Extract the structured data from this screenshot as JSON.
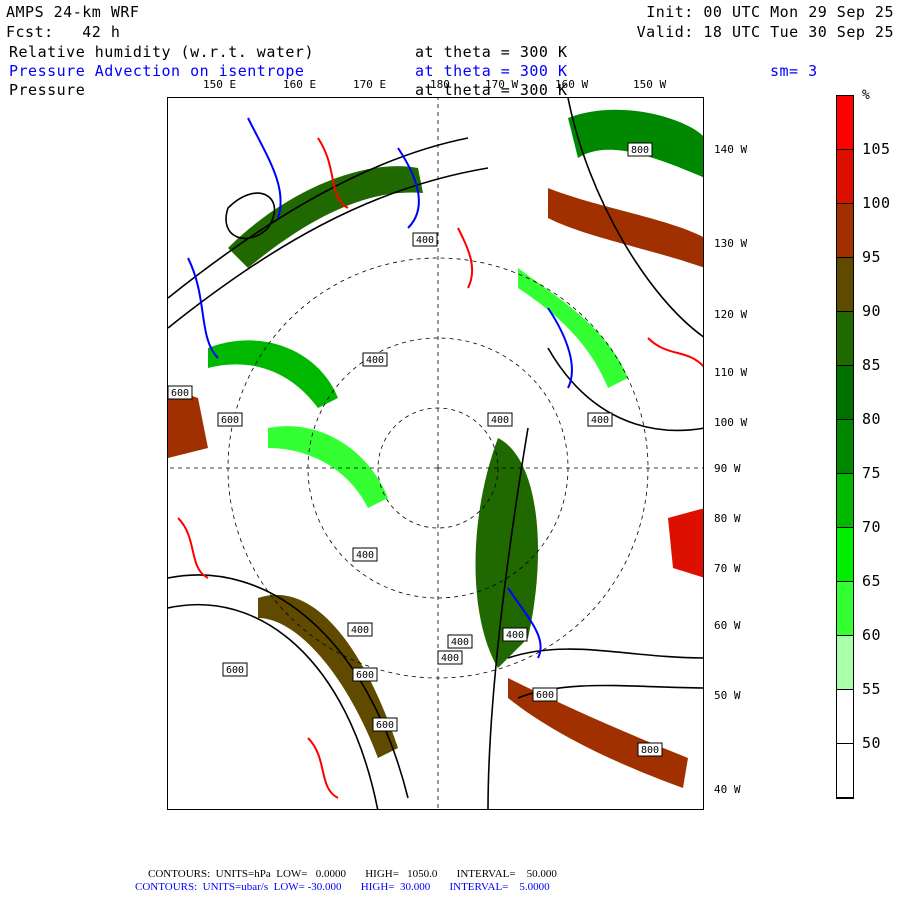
{
  "header": {
    "model": "AMPS 24-km WRF",
    "forecast": "Fcst:   42 h",
    "init": "Init: 00 UTC Mon 29 Sep 25",
    "valid": "Valid: 18 UTC Tue 30 Sep 25",
    "field1": "Relative humidity (w.r.t. water)",
    "field1_level": "at theta = 300 K",
    "field2": "Pressure Advection on isentrope",
    "field2_level": "at theta = 300 K",
    "smoothing": "sm= 3",
    "field3": "Pressure",
    "field3_level": "at theta = 300 K"
  },
  "top_longitudes": [
    "150 E",
    "160 E",
    "170 E",
    "180",
    "170 W",
    "160 W",
    "150 W"
  ],
  "right_longitudes": [
    "140 W",
    "130 W",
    "120 W",
    "110 W",
    "100 W",
    "90 W",
    "80 W",
    "70 W",
    "60 W",
    "50 W",
    "40 W"
  ],
  "contour_labels": [
    "400",
    "400",
    "400",
    "400",
    "400",
    "400",
    "400",
    "400",
    "400",
    "600",
    "600",
    "600",
    "600",
    "600",
    "600",
    "800",
    "800"
  ],
  "colorbar": {
    "unit": "%",
    "labels": [
      "105",
      "100",
      "95",
      "90",
      "85",
      "80",
      "75",
      "70",
      "65",
      "60",
      "55",
      "50"
    ],
    "colors": [
      "#ff0000",
      "#dd1000",
      "#a03000",
      "#604a00",
      "#206800",
      "#007000",
      "#008800",
      "#00b800",
      "#00ee00",
      "#33ff33",
      "#aaffaa",
      "#ffffff",
      "#ffffff"
    ]
  },
  "footer": {
    "line1": "CONTOURS:  UNITS=hPa  LOW=   0.0000       HIGH=   1050.0       INTERVAL=    50.000",
    "line2": "CONTOURS:  UNITS=ubar/s  LOW= -30.000       HIGH=  30.000       INTERVAL=    5.0000"
  }
}
